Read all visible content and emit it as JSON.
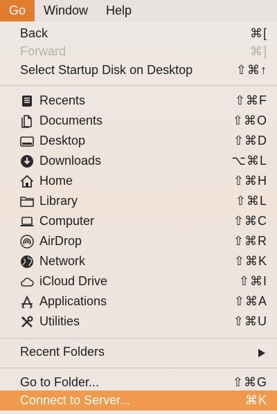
{
  "menubar": {
    "go": "Go",
    "window": "Window",
    "help": "Help"
  },
  "menu": {
    "back": {
      "label": "Back",
      "shortcut": "⌘["
    },
    "forward": {
      "label": "Forward",
      "shortcut": "⌘]"
    },
    "startup": {
      "label": "Select Startup Disk on Desktop",
      "shortcut": "⇧⌘↑"
    },
    "recents": {
      "label": "Recents",
      "shortcut": "⇧⌘F",
      "icon": "recents-icon"
    },
    "documents": {
      "label": "Documents",
      "shortcut": "⇧⌘O",
      "icon": "documents-icon"
    },
    "desktop": {
      "label": "Desktop",
      "shortcut": "⇧⌘D",
      "icon": "desktop-icon"
    },
    "downloads": {
      "label": "Downloads",
      "shortcut": "⌥⌘L",
      "icon": "downloads-icon"
    },
    "home": {
      "label": "Home",
      "shortcut": "⇧⌘H",
      "icon": "home-icon"
    },
    "library": {
      "label": "Library",
      "shortcut": "⇧⌘L",
      "icon": "folder-icon"
    },
    "computer": {
      "label": "Computer",
      "shortcut": "⇧⌘C",
      "icon": "laptop-icon"
    },
    "airdrop": {
      "label": "AirDrop",
      "shortcut": "⇧⌘R",
      "icon": "airdrop-icon"
    },
    "network": {
      "label": "Network",
      "shortcut": "⇧⌘K",
      "icon": "globe-icon"
    },
    "icloud": {
      "label": "iCloud Drive",
      "shortcut": "⇧⌘I",
      "icon": "cloud-icon"
    },
    "applications": {
      "label": "Applications",
      "shortcut": "⇧⌘A",
      "icon": "applications-icon"
    },
    "utilities": {
      "label": "Utilities",
      "shortcut": "⇧⌘U",
      "icon": "utilities-icon"
    },
    "recent_folders": {
      "label": "Recent Folders"
    },
    "go_to_folder": {
      "label": "Go to Folder...",
      "shortcut": "⇧⌘G"
    },
    "connect": {
      "label": "Connect to Server...",
      "shortcut": "⌘K"
    }
  },
  "colors": {
    "menubar_active": "#e27c2f",
    "highlight": "#f19a4d",
    "disabled_text": "#b7b2ae"
  }
}
